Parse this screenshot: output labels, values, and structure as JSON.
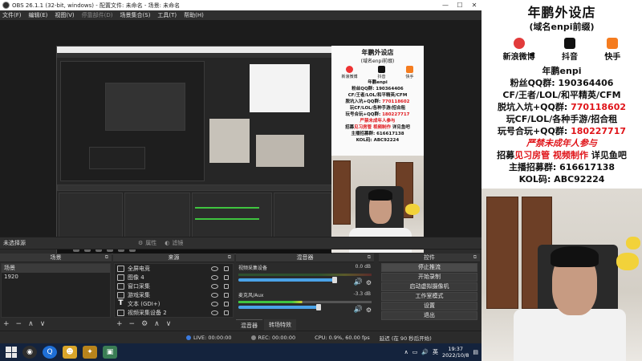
{
  "obs": {
    "title": "OBS 26.1.1 (32-bit, windows) - 配置文件: 未命名 - 场景: 未命名",
    "menu": [
      "文件(F)",
      "编辑(E)",
      "视图(V)",
      "停靠部件(D)",
      "场景集合(S)",
      "工具(T)",
      "帮助(H)"
    ],
    "no_source_selected": "未选择源",
    "properties_label": "属性",
    "filters_label": "滤镜",
    "scenes": {
      "header": "场景",
      "items": [
        "场景",
        "1920"
      ]
    },
    "sources": {
      "header": "来源",
      "items": [
        {
          "label": "全屏电竞",
          "icon": "monitor-icon"
        },
        {
          "label": "图像 4",
          "icon": "image-icon"
        },
        {
          "label": "窗口采集",
          "icon": "window-icon"
        },
        {
          "label": "游戏采集",
          "icon": "gamepad-icon"
        },
        {
          "label": "文本 (GDI+)",
          "icon": "text-icon"
        },
        {
          "label": "视频采集设备 2",
          "icon": "camera-icon"
        }
      ]
    },
    "mixer": {
      "header": "混音器",
      "tracks": [
        {
          "name": "视频采集设备",
          "db": "0.0 dB"
        },
        {
          "name": "麦克风/Aux",
          "db": "-3.3 dB"
        }
      ],
      "tabs": [
        "混音器",
        "转场特效"
      ]
    },
    "controls": {
      "header": "控件",
      "buttons": [
        "停止推流",
        "开始录制",
        "启动虚拟摄像机",
        "工作室模式",
        "设置",
        "退出"
      ]
    },
    "stats": {
      "live": "LIVE: 00:00:00",
      "rec": "REC: 00:00:00",
      "cpu": "CPU: 0.9%, 60.00 fps",
      "delay": "延迟 (在 90 秒后开始)"
    }
  },
  "promo": {
    "title": "年鹏外设店",
    "subtitle": "(域名enpi前缀)",
    "social": [
      {
        "label": "新浪微博",
        "icon": "weibo-icon"
      },
      {
        "label": "抖音",
        "icon": "tiktok-icon"
      },
      {
        "label": "快手",
        "icon": "kuaishou-icon"
      }
    ],
    "handle": "年鹏enpi",
    "lines": [
      {
        "text": "粉丝QQ群: ",
        "red": "",
        "tail": "190364406"
      },
      {
        "text": "CF/王者/LOL/和平精英/CFM",
        "red": "",
        "tail": ""
      },
      {
        "text": "脱坑入坑+QQ群: ",
        "red": "770118602",
        "tail": ""
      },
      {
        "text": "玩CF/LOL/各种手游/招合租",
        "red": "",
        "tail": ""
      },
      {
        "text": "玩号合玩+QQ群: ",
        "red": "180227717",
        "tail": ""
      }
    ],
    "warning": "严禁未成年人参与",
    "recruit_prefix": "招募",
    "recruit_red": "见习房管 视频制作",
    "recruit_suffix": " 详见鱼吧",
    "host_group": "主播招募群: 616617138",
    "kol": "KOL码: ABC92224"
  },
  "taskbar": {
    "apps": [
      "start-icon",
      "obs-icon",
      "browser-icon",
      "game-icon",
      "lol-icon",
      "window-app-icon"
    ],
    "lang": "英",
    "time": "19:37",
    "date": "2022/10/8"
  }
}
